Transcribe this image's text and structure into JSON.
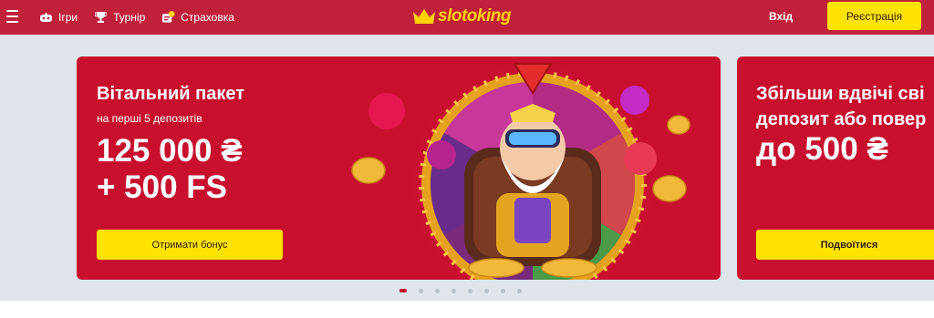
{
  "header": {
    "nav": [
      {
        "label": "Ігри",
        "icon": "gamepad-icon"
      },
      {
        "label": "Турнір",
        "icon": "trophy-icon"
      },
      {
        "label": "Страховка",
        "icon": "insurance-icon"
      }
    ],
    "logo_text": "slotoking",
    "login_label": "Вхід",
    "register_label": "Реєстрація"
  },
  "slides": [
    {
      "title": "Вітальний пакет",
      "subtitle": "на перші 5 депозитів",
      "amount_line1": "125 000 ₴",
      "amount_line2": "+ 500 FS",
      "button_label": "Отримати бонус"
    },
    {
      "title_line1": "Збільши вдвічі сві",
      "title_line2": "депозит або повер",
      "amount": "до 500 ₴",
      "button_label": "Подвоїтися"
    }
  ],
  "carousel": {
    "total": 8,
    "active_index": 0
  },
  "colors": {
    "header": "#c0213a",
    "slide": "#c8102e",
    "accent": "#ffe300",
    "logo": "#ffd200",
    "background": "#dfe5ea"
  }
}
